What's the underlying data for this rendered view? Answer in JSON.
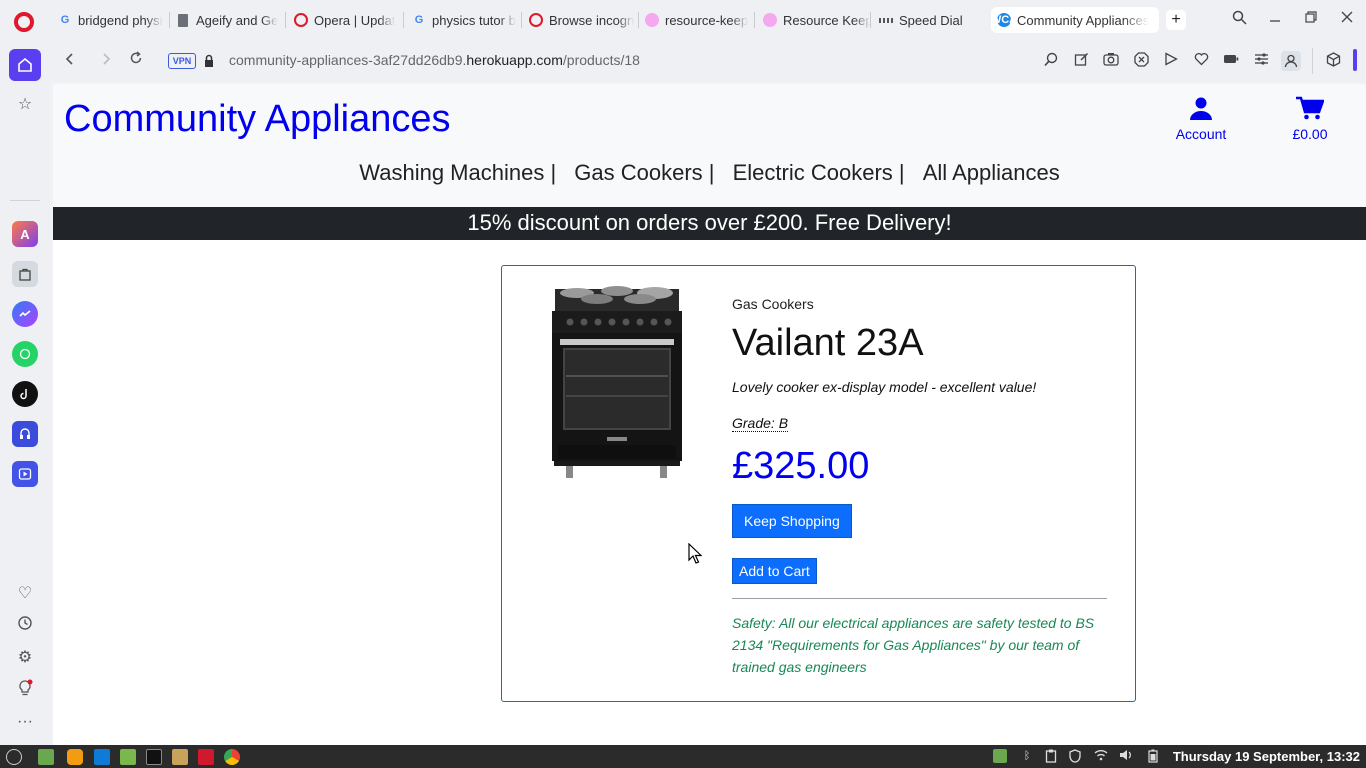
{
  "browser": {
    "tabs": [
      {
        "title": "bridgend physi",
        "favicon": "google-icon",
        "active": false
      },
      {
        "title": "Ageify and Ge",
        "favicon": "document-icon",
        "active": false
      },
      {
        "title": "Opera | Updat",
        "favicon": "opera-icon",
        "active": false
      },
      {
        "title": "physics tutor b",
        "favicon": "google-icon",
        "active": false
      },
      {
        "title": "Browse incogn",
        "favicon": "opera-icon",
        "active": false
      },
      {
        "title": "resource-keep",
        "favicon": "pink-circle-icon",
        "active": false
      },
      {
        "title": "Resource Keep",
        "favicon": "pink-circle-icon",
        "active": false
      },
      {
        "title": "Speed Dial",
        "favicon": "grid-icon",
        "active": false
      },
      {
        "title": "Community Appliances",
        "favicon": "wca-icon",
        "active": true
      }
    ],
    "favicon_texts": {
      "google": "G",
      "wca": "WCA"
    },
    "new_tab_label": "+",
    "address": {
      "vpn_label": "VPN",
      "url_prefix": "community-appliances-3af27dd26db9.",
      "url_domain": "herokuapp.com",
      "url_path": "/products/18"
    }
  },
  "site": {
    "title": "Community Appliances",
    "account_label": "Account",
    "cart_total": "£0.00",
    "nav": [
      "Washing Machines |",
      "Gas Cookers |",
      "Electric Cookers |",
      "All Appliances"
    ],
    "banner": "15% discount on orders over £200. Free Delivery!"
  },
  "product": {
    "category": "Gas Cookers",
    "name": "Vailant 23A",
    "description": "Lovely cooker ex-display model - excellent value!",
    "grade": "Grade: B",
    "price": "£325.00",
    "keep_shopping_label": "Keep Shopping",
    "add_to_cart_label": "Add to Cart",
    "safety_note": "Safety: All our electrical appliances are safety tested to BS 2134 \"Requirements for Gas Appliances\" by our team of trained gas engineers"
  },
  "taskbar": {
    "clock": "Thursday 19 September, 13:32"
  },
  "colors": {
    "link_blue": "#0000ee",
    "button_blue": "#0d6efd",
    "banner_bg": "#212529",
    "safety_green": "#198754",
    "card_border": "#1c6ea4",
    "opera_red": "#e0182d",
    "sidebar_accent": "#5a3ff0"
  }
}
